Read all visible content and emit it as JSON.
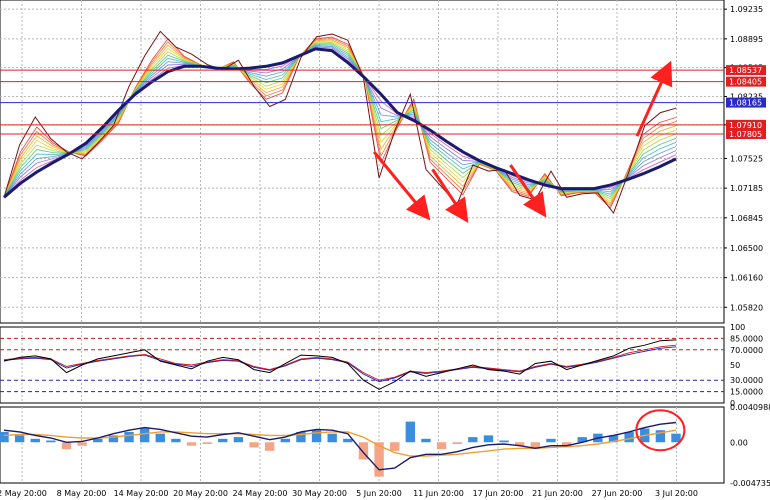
{
  "colors": {
    "background": "#ffffff",
    "grid": "#b8b8b8",
    "ema_base": "#1b1b6e",
    "hline_red": "#e02020",
    "hline_blue": "#2a2ac8",
    "arrow": "#ff2020",
    "price_line": "#7a1010",
    "macd_pos": "#3b8ede",
    "macd_neg": "#f4a585",
    "macd_line": "#1b1b6e",
    "signal_line": "#f0a030",
    "rsi_red": "#d01818",
    "rsi_blue": "#2020c0"
  },
  "chart_data": [
    {
      "type": "line",
      "name": "price-panel",
      "x_labels": [
        "2 May 20:00",
        "8 May 20:00",
        "14 May 20:00",
        "20 May 20:00",
        "24 May 20:00",
        "30 May 20:00",
        "5 Jun 20:00",
        "11 Jun 20:00",
        "17 Jun 20:00",
        "21 Jun 20:00",
        "27 Jun 20:00",
        "3 Jul 20:00"
      ],
      "y_ticks": [
        "1.09235",
        "1.08895",
        "1.08565",
        "1.08235",
        "1.07910",
        "1.07525",
        "1.07185",
        "1.06845",
        "1.06500",
        "1.06160",
        "1.05820"
      ],
      "ylim": [
        1.0564,
        1.0934
      ],
      "price": [
        1.0708,
        1.0768,
        1.08,
        1.0775,
        1.076,
        1.0752,
        1.077,
        1.079,
        1.0835,
        1.087,
        1.0898,
        1.088,
        1.0872,
        1.086,
        1.0854,
        1.0865,
        1.0835,
        1.0812,
        1.082,
        1.0868,
        1.0892,
        1.0895,
        1.0888,
        1.0845,
        1.073,
        1.0784,
        1.0826,
        1.074,
        1.072,
        1.07,
        1.0745,
        1.0738,
        1.074,
        1.071,
        1.0705,
        1.0738,
        1.0708,
        1.0712,
        1.0713,
        1.069,
        1.0738,
        1.079,
        1.0805,
        1.081
      ],
      "ema_base": [
        1.0708,
        1.0724,
        1.0737,
        1.0748,
        1.0758,
        1.077,
        1.0788,
        1.0808,
        1.0826,
        1.084,
        1.0852,
        1.0858,
        1.0858,
        1.0856,
        1.0855,
        1.0856,
        1.0858,
        1.0862,
        1.087,
        1.0878,
        1.0876,
        1.0862,
        1.0845,
        1.0826,
        1.0805,
        1.0796,
        1.0785,
        1.0772,
        1.076,
        1.075,
        1.0742,
        1.0735,
        1.0728,
        1.0722,
        1.0718,
        1.0718,
        1.0718,
        1.0722,
        1.0728,
        1.0735,
        1.0743,
        1.0752
      ],
      "red_lines": [
        1.08537,
        1.08405,
        1.0791,
        1.07805
      ],
      "blue_line": 1.08165,
      "price_tags": [
        {
          "text": "1.08537",
          "value": 1.08537
        },
        {
          "text": "1.08405",
          "value": 1.08405
        },
        {
          "text": "1.08165",
          "value": 1.08165
        },
        {
          "text": "1.07910",
          "value": 1.0791
        },
        {
          "text": "1.07805",
          "value": 1.07805
        }
      ],
      "arrows": [
        {
          "from": [
            38,
            1.076
          ],
          "to": [
            43,
            1.0692
          ]
        },
        {
          "from": [
            44,
            1.074
          ],
          "to": [
            47,
            1.069
          ]
        },
        {
          "from": [
            52,
            1.0745
          ],
          "to": [
            55,
            1.0696
          ]
        },
        {
          "from": [
            65,
            1.0778
          ],
          "to": [
            68,
            1.0852
          ]
        }
      ]
    },
    {
      "type": "line",
      "name": "rsi-panel",
      "y_ticks": [
        "100",
        "85.0000",
        "70.0000",
        "50",
        "30.0000",
        "15.0000",
        "0"
      ],
      "ylim": [
        0,
        100
      ],
      "levels_red": [
        85,
        70
      ],
      "levels_blue": [
        30,
        15
      ],
      "series_black": [
        55,
        60,
        62,
        58,
        40,
        50,
        58,
        62,
        66,
        70,
        55,
        50,
        45,
        55,
        60,
        57,
        44,
        40,
        52,
        63,
        62,
        60,
        52,
        30,
        18,
        28,
        42,
        35,
        40,
        45,
        50,
        44,
        42,
        38,
        52,
        55,
        44,
        50,
        56,
        62,
        72,
        76,
        82,
        83
      ],
      "series_red": [
        57,
        59,
        60,
        58,
        48,
        52,
        56,
        59,
        62,
        64,
        58,
        52,
        50,
        54,
        57,
        56,
        48,
        44,
        50,
        58,
        60,
        58,
        54,
        40,
        30,
        34,
        42,
        40,
        42,
        45,
        48,
        46,
        44,
        42,
        48,
        52,
        48,
        51,
        55,
        60,
        66,
        70,
        74,
        76
      ],
      "series_blue": [
        56,
        58,
        59,
        57,
        46,
        51,
        55,
        58,
        61,
        63,
        56,
        51,
        48,
        53,
        56,
        55,
        47,
        43,
        49,
        57,
        59,
        57,
        53,
        38,
        28,
        33,
        41,
        39,
        41,
        44,
        47,
        45,
        43,
        41,
        47,
        51,
        47,
        50,
        54,
        59,
        64,
        68,
        72,
        74
      ]
    },
    {
      "type": "bar",
      "name": "macd-panel",
      "y_ticks": [
        "0.0040988",
        "0.00",
        "-0.0047358"
      ],
      "ylim": [
        -0.0047358,
        0.0040988
      ],
      "histogram": [
        0.0012,
        0.0008,
        0.0004,
        0.0002,
        -0.0008,
        -0.0004,
        0.0004,
        0.0008,
        0.0012,
        0.0016,
        0.001,
        0.0004,
        -0.0004,
        -0.0002,
        0.0004,
        0.0006,
        -0.0006,
        -0.001,
        0.0004,
        0.0012,
        0.0014,
        0.001,
        0.0004,
        -0.002,
        -0.004,
        -0.001,
        0.0024,
        0.0004,
        -0.0008,
        -0.0002,
        0.0006,
        0.0008,
        0.0002,
        -0.0004,
        -0.0008,
        0.0004,
        -0.0006,
        0.0006,
        0.001,
        0.0008,
        0.0012,
        0.0016,
        0.0014,
        0.001
      ],
      "macd": [
        0.0014,
        0.0012,
        0.0008,
        0.0005,
        0.0,
        0.0001,
        0.0005,
        0.001,
        0.0014,
        0.0017,
        0.0015,
        0.0011,
        0.0007,
        0.0006,
        0.0009,
        0.0011,
        0.0007,
        0.0003,
        0.0006,
        0.0012,
        0.0015,
        0.0014,
        0.001,
        -0.0012,
        -0.0032,
        -0.003,
        -0.0018,
        -0.0014,
        -0.0014,
        -0.0011,
        -0.0006,
        -0.0003,
        -0.0002,
        -0.0004,
        -0.0007,
        -0.0004,
        -0.0004,
        0.0,
        0.0005,
        0.0008,
        0.0012,
        0.0017,
        0.0021,
        0.0023
      ],
      "signal": [
        0.0008,
        0.0009,
        0.0009,
        0.0008,
        0.0006,
        0.0005,
        0.0005,
        0.0006,
        0.0008,
        0.001,
        0.0012,
        0.0012,
        0.0011,
        0.001,
        0.001,
        0.001,
        0.0009,
        0.0008,
        0.0008,
        0.0009,
        0.0011,
        0.0012,
        0.0012,
        0.0006,
        -0.0004,
        -0.0012,
        -0.0016,
        -0.0016,
        -0.0015,
        -0.0014,
        -0.0012,
        -0.001,
        -0.0008,
        -0.0007,
        -0.0007,
        -0.0006,
        -0.0005,
        -0.0004,
        -0.0002,
        0.0001,
        0.0004,
        0.0008,
        0.0011,
        0.0014
      ]
    }
  ]
}
